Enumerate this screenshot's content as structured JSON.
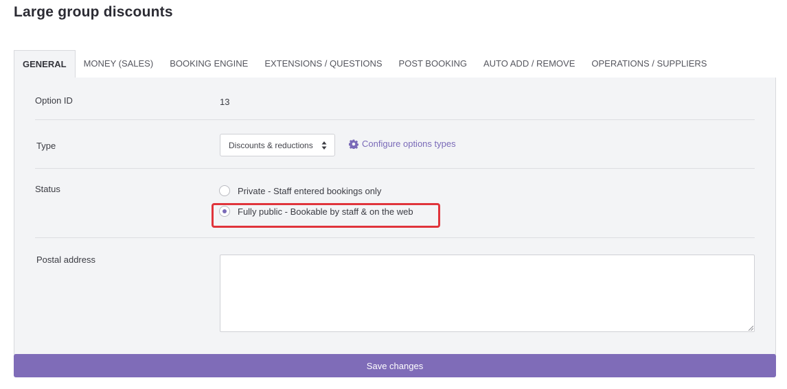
{
  "page": {
    "title": "Large group discounts"
  },
  "tabs": [
    {
      "label": "GENERAL",
      "active": true
    },
    {
      "label": "MONEY (SALES)"
    },
    {
      "label": "BOOKING ENGINE"
    },
    {
      "label": "EXTENSIONS / QUESTIONS"
    },
    {
      "label": "POST BOOKING"
    },
    {
      "label": "AUTO ADD / REMOVE"
    },
    {
      "label": "OPERATIONS / SUPPLIERS"
    }
  ],
  "form": {
    "option_id": {
      "label": "Option ID",
      "value": "13"
    },
    "type": {
      "label": "Type",
      "selected": "Discounts & reductions",
      "configure_link": "Configure options types"
    },
    "status": {
      "label": "Status",
      "options": [
        {
          "label": "Private - Staff entered bookings only",
          "checked": false
        },
        {
          "label": "Fully public - Bookable by staff & on the web",
          "checked": true
        }
      ]
    },
    "postal_address": {
      "label": "Postal address",
      "value": ""
    }
  },
  "actions": {
    "save_label": "Save changes"
  },
  "colors": {
    "accent": "#7f6cb8",
    "highlight": "#e0343b",
    "panel_bg": "#f3f4f6"
  }
}
